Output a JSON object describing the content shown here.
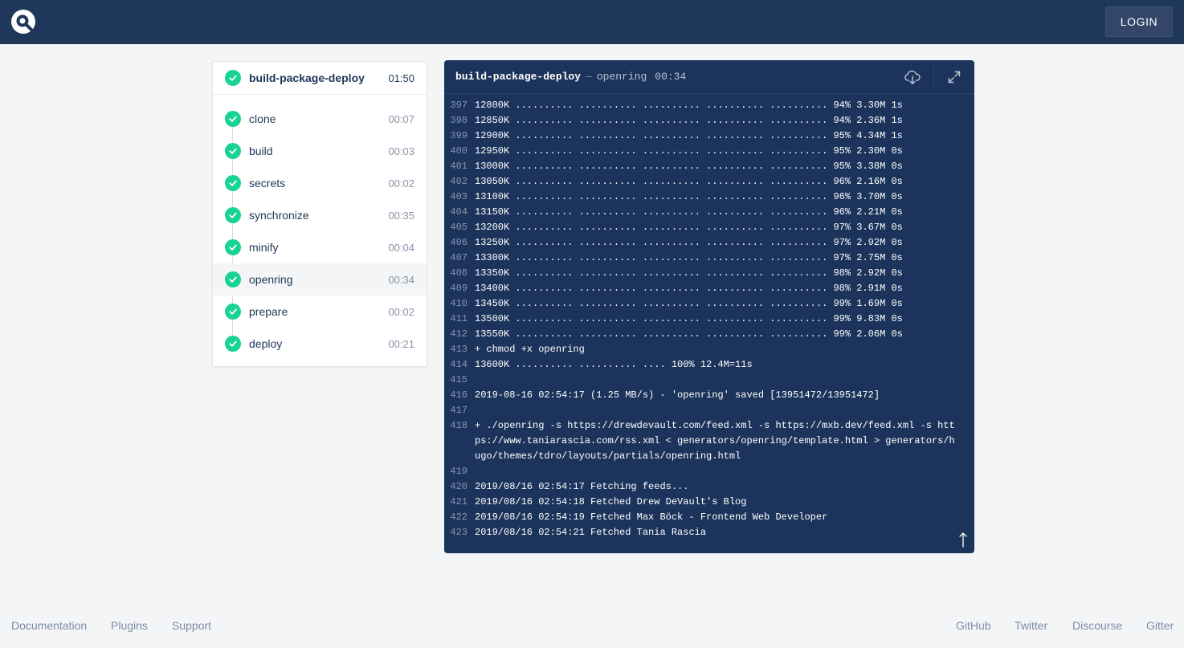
{
  "header": {
    "login_label": "LOGIN"
  },
  "pipeline": {
    "name": "build-package-deploy",
    "duration": "01:50"
  },
  "stages": [
    {
      "name": "clone",
      "duration": "00:07"
    },
    {
      "name": "build",
      "duration": "00:03"
    },
    {
      "name": "secrets",
      "duration": "00:02"
    },
    {
      "name": "synchronize",
      "duration": "00:35"
    },
    {
      "name": "minify",
      "duration": "00:04"
    },
    {
      "name": "openring",
      "duration": "00:34",
      "active": true
    },
    {
      "name": "prepare",
      "duration": "00:02"
    },
    {
      "name": "deploy",
      "duration": "00:21"
    }
  ],
  "log": {
    "pipeline": "build-package-deploy",
    "separator": "—",
    "stage": "openring",
    "duration": "00:34",
    "lines": [
      {
        "n": "397",
        "t": "12800K .......... .......... .......... .......... .......... 94% 3.30M 1s"
      },
      {
        "n": "398",
        "t": "12850K .......... .......... .......... .......... .......... 94% 2.36M 1s"
      },
      {
        "n": "399",
        "t": "12900K .......... .......... .......... .......... .......... 95% 4.34M 1s"
      },
      {
        "n": "400",
        "t": "12950K .......... .......... .......... .......... .......... 95% 2.30M 0s"
      },
      {
        "n": "401",
        "t": "13000K .......... .......... .......... .......... .......... 95% 3.38M 0s"
      },
      {
        "n": "402",
        "t": "13050K .......... .......... .......... .......... .......... 96% 2.16M 0s"
      },
      {
        "n": "403",
        "t": "13100K .......... .......... .......... .......... .......... 96% 3.70M 0s"
      },
      {
        "n": "404",
        "t": "13150K .......... .......... .......... .......... .......... 96% 2.21M 0s"
      },
      {
        "n": "405",
        "t": "13200K .......... .......... .......... .......... .......... 97% 3.67M 0s"
      },
      {
        "n": "406",
        "t": "13250K .......... .......... .......... .......... .......... 97% 2.92M 0s"
      },
      {
        "n": "407",
        "t": "13300K .......... .......... .......... .......... .......... 97% 2.75M 0s"
      },
      {
        "n": "408",
        "t": "13350K .......... .......... .......... .......... .......... 98% 2.92M 0s"
      },
      {
        "n": "409",
        "t": "13400K .......... .......... .......... .......... .......... 98% 2.91M 0s"
      },
      {
        "n": "410",
        "t": "13450K .......... .......... .......... .......... .......... 99% 1.69M 0s"
      },
      {
        "n": "411",
        "t": "13500K .......... .......... .......... .......... .......... 99% 9.83M 0s"
      },
      {
        "n": "412",
        "t": "13550K .......... .......... .......... .......... .......... 99% 2.06M 0s"
      },
      {
        "n": "413",
        "t": "+ chmod +x openring"
      },
      {
        "n": "414",
        "t": "13600K .......... .......... .... 100% 12.4M=11s"
      },
      {
        "n": "415",
        "t": ""
      },
      {
        "n": "416",
        "t": "2019-08-16 02:54:17 (1.25 MB/s) - 'openring' saved [13951472/13951472]"
      },
      {
        "n": "417",
        "t": ""
      },
      {
        "n": "418",
        "t": "+ ./openring -s https://drewdevault.com/feed.xml -s https://mxb.dev/feed.xml -s https://www.taniarascia.com/rss.xml < generators/openring/template.html > generators/hugo/themes/tdro/layouts/partials/openring.html"
      },
      {
        "n": "419",
        "t": ""
      },
      {
        "n": "420",
        "t": "2019/08/16 02:54:17 Fetching feeds..."
      },
      {
        "n": "421",
        "t": "2019/08/16 02:54:18 Fetched Drew DeVault's Blog"
      },
      {
        "n": "422",
        "t": "2019/08/16 02:54:19 Fetched Max Böck - Frontend Web Developer"
      },
      {
        "n": "423",
        "t": "2019/08/16 02:54:21 Fetched Tania Rascia"
      }
    ]
  },
  "footer": {
    "left": [
      "Documentation",
      "Plugins",
      "Support"
    ],
    "right": [
      "GitHub",
      "Twitter",
      "Discourse",
      "Gitter"
    ]
  },
  "colors": {
    "brand_navy": "#1e375a",
    "success_green": "#19d393",
    "log_background": "#1c345b"
  },
  "icons": {
    "logo": "drone-logo-icon",
    "status": "check-circle-icon",
    "download": "cloud-download-icon",
    "expand": "expand-icon",
    "scroll_top": "arrow-up-icon"
  }
}
